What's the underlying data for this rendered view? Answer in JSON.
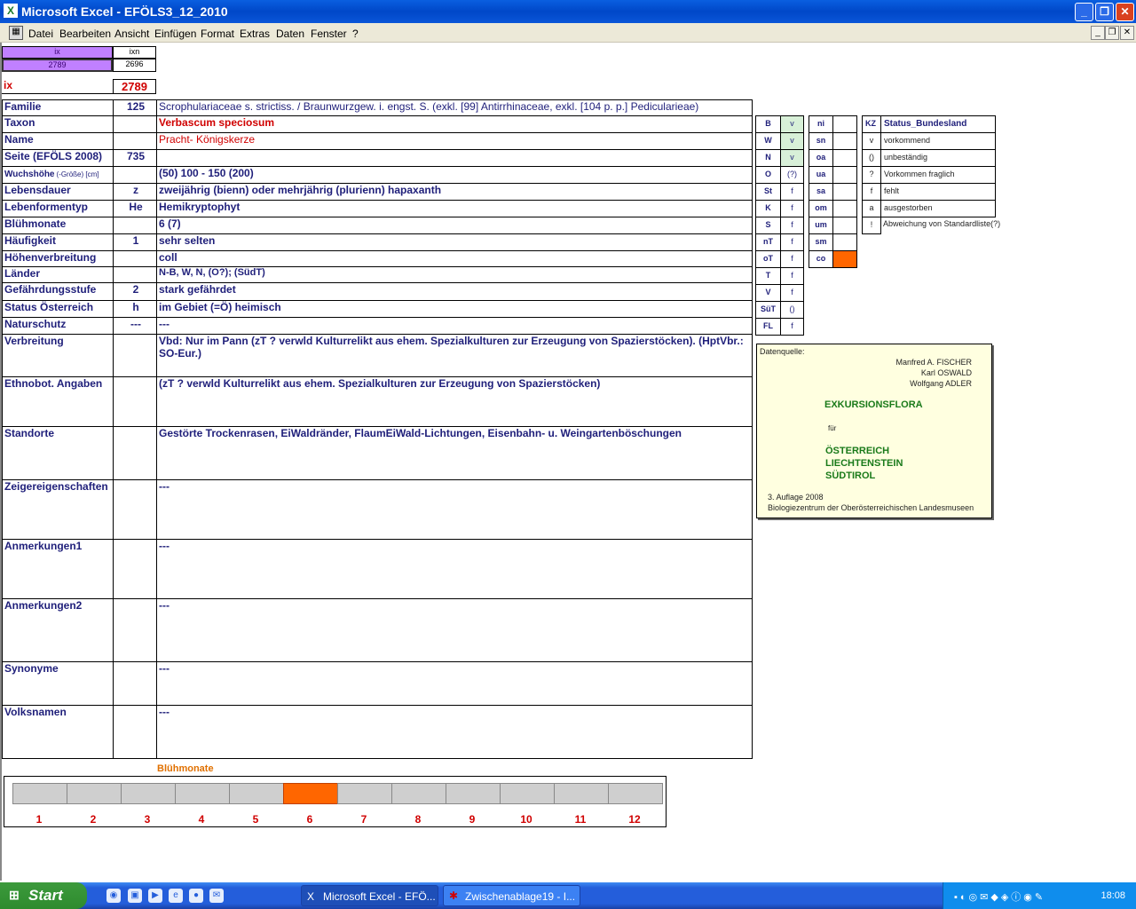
{
  "window": {
    "title": "Microsoft Excel - EFÖLS3_12_2010"
  },
  "menu": [
    "Datei",
    "Bearbeiten",
    "Ansicht",
    "Einfügen",
    "Format",
    "Extras",
    "Daten",
    "Fenster",
    "?"
  ],
  "index": {
    "ix_label": "ix",
    "ixn_label": "ixn",
    "ix_value": "2789",
    "ixn_value": "2696",
    "ix_big_label": "ix",
    "ix_big_value": "2789"
  },
  "rows": [
    {
      "label": "Familie",
      "code": "125",
      "value": "Scrophulariaceae s. strictiss.  /  Braunwurzgew. i. engst. S. (exkl. [99] Antirrhinaceae, exkl. [104 p. p.] Pedicularieae)"
    },
    {
      "label": "Taxon",
      "code": "",
      "value": "Verbascum speciosum"
    },
    {
      "label": "Name",
      "code": "",
      "value": "Pracht- Königskerze"
    },
    {
      "label": "Seite (EFÖLS 2008)",
      "code": "735",
      "value": ""
    },
    {
      "label": "Wuchshöhe",
      "label2": "(-Größe) [cm]",
      "code": "",
      "value": "(50) 100 - 150 (200)"
    },
    {
      "label": "Lebensdauer",
      "code": "z",
      "value": "zweijährig (bienn) oder mehrjährig (plurienn) hapaxanth"
    },
    {
      "label": "Lebenformentyp",
      "code": "He",
      "value": "Hemikryptophyt"
    },
    {
      "label": "Blühmonate",
      "code": "",
      "value": "6 (7)"
    },
    {
      "label": "Häufigkeit",
      "code": "1",
      "value": "sehr selten"
    },
    {
      "label": "Höhenverbreitung",
      "code": "",
      "value": "coll"
    },
    {
      "label": "Länder",
      "code": "",
      "value": "N-B, W, N, (O?); (SüdT)"
    },
    {
      "label": "Gefährdungsstufe",
      "code": "2",
      "value": "stark gefährdet"
    },
    {
      "label": "Status Österreich",
      "code": "h",
      "value": "im Gebiet (=Ö) heimisch"
    },
    {
      "label": "Naturschutz",
      "code": "---",
      "value": "---"
    },
    {
      "label": "Verbreitung",
      "code": "",
      "value": "Vbd: Nur im Pann (zT ? verwld Kulturrelikt aus ehem. Spezialkulturen zur Erzeugung von Spazierstöcken). (HptVbr.: SO-Eur.)"
    },
    {
      "label": "Ethnobot. Angaben",
      "code": "",
      "value": "(zT ? verwld Kulturrelikt aus ehem. Spezialkulturen zur Erzeugung von Spazierstöcken)"
    },
    {
      "label": "Standorte",
      "code": "",
      "value": "Gestörte Trockenrasen, EiWaldränder, FlaumEiWald-Lichtungen, Eisenbahn- u. Weingartenböschungen"
    },
    {
      "label": "Zeigereigenschaften",
      "code": "",
      "value": "---"
    },
    {
      "label": "Anmerkungen1",
      "code": "",
      "value": "---"
    },
    {
      "label": "Anmerkungen2",
      "code": "",
      "value": "---"
    },
    {
      "label": "Synonyme",
      "code": "",
      "value": "---"
    },
    {
      "label": "Volksnamen",
      "code": "",
      "value": "---"
    }
  ],
  "states": [
    {
      "k": "B",
      "v": "v"
    },
    {
      "k": "W",
      "v": "v"
    },
    {
      "k": "N",
      "v": "v"
    },
    {
      "k": "O",
      "v": "(?)"
    },
    {
      "k": "St",
      "v": "f"
    },
    {
      "k": "K",
      "v": "f"
    },
    {
      "k": "S",
      "v": "f"
    },
    {
      "k": "nT",
      "v": "f"
    },
    {
      "k": "oT",
      "v": "f"
    },
    {
      "k": "T",
      "v": "f"
    },
    {
      "k": "V",
      "v": "f"
    },
    {
      "k": "SüT",
      "v": "()"
    },
    {
      "k": "FL",
      "v": "f"
    }
  ],
  "altitudes": [
    "ni",
    "sn",
    "oa",
    "ua",
    "sa",
    "om",
    "um",
    "sm",
    "co"
  ],
  "legend": {
    "header_kz": "KZ",
    "header": "Status_Bundesland",
    "items": [
      {
        "k": "v",
        "t": "vorkommend"
      },
      {
        "k": "()",
        "t": "unbeständig"
      },
      {
        "k": "?",
        "t": "Vorkommen fraglich"
      },
      {
        "k": "f",
        "t": "fehlt"
      },
      {
        "k": "a",
        "t": "ausgestorben"
      },
      {
        "k": "!",
        "t": "Abweichung von Standardliste(?)"
      }
    ]
  },
  "source": {
    "label": "Datenquelle:",
    "a1": "Manfred A. FISCHER",
    "a2": "Karl OSWALD",
    "a3": "Wolfgang ADLER",
    "title": "EXKURSIONSFLORA",
    "fuer": "für",
    "c1": "ÖSTERREICH",
    "c2": "LIECHTENSTEIN",
    "c3": "SÜDTIROL",
    "ed": "3. Auflage 2008",
    "pub": "Biologiezentrum der Oberösterreichischen Landesmuseen"
  },
  "bluehmonate": {
    "title": "Blühmonate",
    "months": [
      "1",
      "2",
      "3",
      "4",
      "5",
      "6",
      "7",
      "8",
      "9",
      "10",
      "11",
      "12"
    ],
    "active": [
      6
    ]
  },
  "taskbar": {
    "start": "Start",
    "tasks": [
      "Microsoft Excel - EFÖ...",
      "Zwischenablage19 - I..."
    ],
    "clock": "18:08"
  },
  "colors": {
    "accent_orange": "#ff6600",
    "index_purple": "#c080ff",
    "title_blue": "#0047c8"
  }
}
